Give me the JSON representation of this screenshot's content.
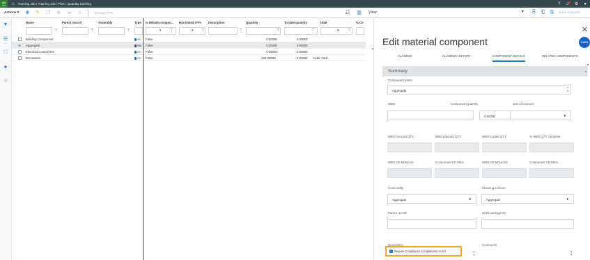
{
  "topbar": {
    "menu_icon": "menu-icon",
    "home_icon": "home-icon",
    "breadcrumb": "Training Job / Training Job  /  Plan  /  Quantity tracking",
    "right_icons": [
      "help-icon",
      "notifications-icon",
      "settings-icon",
      "account-icon"
    ],
    "bar_color": "#37474f",
    "menu_color": "#2e7d32"
  },
  "toolbar": {
    "actions_label": "Actions ▾",
    "manage_label": "Manage ITPs",
    "view_label": "View",
    "save_label": "Save changes"
  },
  "grid": {
    "columns": [
      "Name",
      "Parent record",
      "Assembly",
      "Type",
      "Is default compon...",
      "Has linked ITPs",
      "Description",
      "Quantity",
      "To date quantity",
      "UoM",
      "% Co"
    ],
    "rows": [
      {
        "name": "Building Component",
        "type": "Ac",
        "dot": "blue",
        "is_default": "False",
        "quantity": "0.00000",
        "to_date": "0.00000",
        "uom": ""
      },
      {
        "name": "Aggregate",
        "type": "Ma",
        "dot": "dark",
        "is_default": "False",
        "quantity": "0.00000",
        "to_date": "0.00000",
        "uom": ""
      },
      {
        "name": "Electrical component",
        "type": "Ac",
        "dot": "blue",
        "is_default": "False",
        "quantity": "0.00000",
        "to_date": "0.00000",
        "uom": ""
      },
      {
        "name": "Excavation",
        "type": "Ac",
        "dot": "blue",
        "is_default": "False",
        "quantity": "250.00000",
        "to_date": "0.00000",
        "uom": "Cubic Yard"
      }
    ],
    "selected_row": 1
  },
  "panel": {
    "title": "Edit material component",
    "percent": "0.00%",
    "tabs": [
      "CLAIMING",
      "CLAIMING HISTORY",
      "COMPONENT DETAILS",
      "RELATED COMPONENTS"
    ],
    "active_tab": 2,
    "summary_label": "Summary",
    "component_name_label": "Component name",
    "component_name_value": "Aggregate",
    "wbs_label": "WBS",
    "component_quantity_label": "Component quantity",
    "component_quantity_value": "0.00000",
    "unit_label": "Unit of measure",
    "wbs_forecast_label": "WBS forecast QTY",
    "wbs_planned_label": "WBS planned QTY",
    "wbs_todate_label": "WBS to date QTY",
    "wbs_complete_label": "% WBS QTY complete",
    "wbs_ce_label": "WBS CE Mhrs/unit",
    "comp_ce_label": "Component CE Mhrs",
    "wbs_cb_label": "WBS CB Mhrs/unit",
    "comp_cb_label": "Component CB Mhrs",
    "commodity_label": "Commodity",
    "commodity_value": "Aggregate",
    "claiming_scheme_label": "Claiming scheme",
    "claiming_scheme_value": "Aggregate",
    "parent_record_label": "Parent record",
    "work_package_label": "Work package ID",
    "description_label": "Description",
    "comments_label": "Comments",
    "require_label": "Require Compliance Completions record",
    "accent": "#1976d2",
    "highlight": "#f4a932"
  }
}
